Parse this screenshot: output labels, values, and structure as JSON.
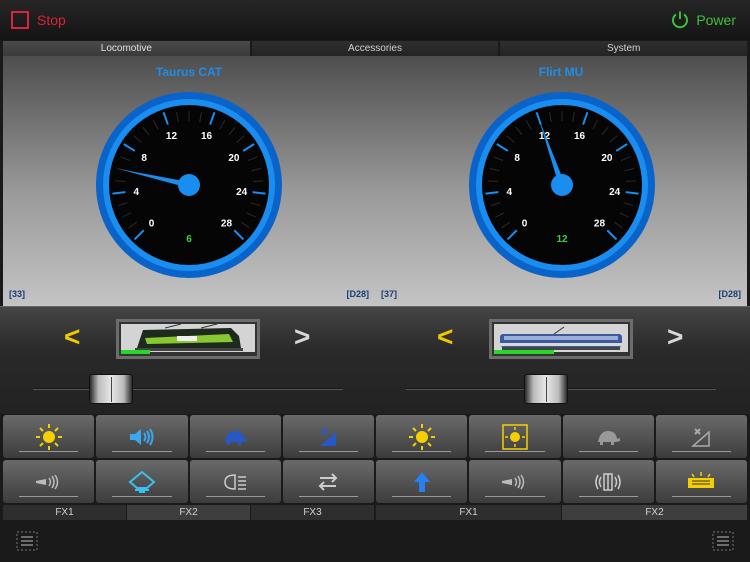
{
  "topbar": {
    "stop_label": "Stop",
    "power_label": "Power"
  },
  "tabs": [
    {
      "label": "Locomotive",
      "active": true
    },
    {
      "label": "Accessories",
      "active": false
    },
    {
      "label": "System",
      "active": false
    }
  ],
  "gauge_ticks": [
    "0",
    "4",
    "8",
    "12",
    "16",
    "20",
    "24",
    "28"
  ],
  "locos": [
    {
      "name": "Taurus CAT",
      "speed_value": "6",
      "speed_step": 6,
      "max_step": 28,
      "address": "[33]",
      "mode": "[D28]",
      "throttle_fraction": 0.25,
      "speed_bar_fraction": 0.22,
      "function_groups": [
        "FX1",
        "FX2",
        "FX3"
      ],
      "active_group": 1,
      "functions": [
        "light-icon",
        "sound-icon",
        "turtle-icon",
        "decouple-icon",
        "horn-icon",
        "pantograph-icon",
        "headlight-icon",
        "shunting-icon"
      ]
    },
    {
      "name": "Flirt MU",
      "speed_value": "12",
      "speed_step": 12,
      "max_step": 28,
      "address": "[37]",
      "mode": "[D28]",
      "throttle_fraction": 0.45,
      "speed_bar_fraction": 0.45,
      "function_groups": [
        "FX1",
        "FX2"
      ],
      "active_group": 1,
      "functions": [
        "light-icon",
        "cab-light-icon",
        "turtle-icon",
        "decouple-icon",
        "arrow-up-icon",
        "horn-icon",
        "door-sound-icon",
        "x410-icon"
      ]
    }
  ],
  "colors": {
    "accent_blue": "#1e8ee8",
    "stop_red": "#d9243a",
    "power_green": "#3fbf3f",
    "function_yellow": "#f0c800"
  }
}
